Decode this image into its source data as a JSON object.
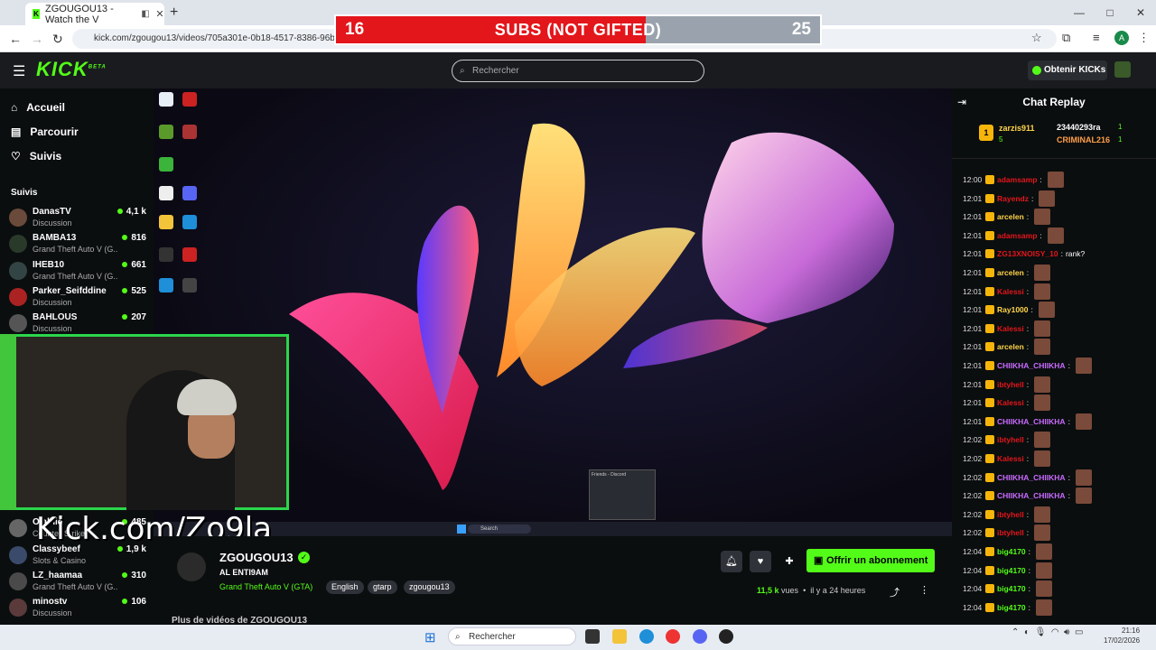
{
  "browser": {
    "tab_title": "ZGOUGOU13 - Watch the V",
    "tab_favicon": "kick-icon",
    "new_tab": "+",
    "url": "kick.com/zgougou13/videos/705a301e-0b18-4517-8386-96bb84",
    "profile_initial": "A",
    "window_controls": [
      "—",
      "□",
      "✕"
    ]
  },
  "overlay": {
    "sub_goal_current": "16",
    "sub_goal_label": "SUBS (NOT GIFTED)",
    "sub_goal_target": "25",
    "sub_goal_progress": 0.64,
    "kick_link": "Kick.com/Zo9la"
  },
  "header": {
    "logo": "KICK",
    "logo_badge": "BETA",
    "search_placeholder": "Rechercher",
    "kicks_button": "Obtenir KICKs"
  },
  "sidebar": {
    "nav": [
      {
        "label": "Accueil",
        "icon": "home-icon"
      },
      {
        "label": "Parcourir",
        "icon": "browse-icon"
      },
      {
        "label": "Suivis",
        "icon": "heart-icon"
      }
    ],
    "following_header": "Suivis",
    "channels": [
      {
        "name": "DanasTV",
        "category": "Discussion",
        "viewers": "4,1 k"
      },
      {
        "name": "BAMBA13",
        "category": "Grand Theft Auto V (G...",
        "viewers": "816"
      },
      {
        "name": "IHEB10",
        "category": "Grand Theft Auto V (G...",
        "viewers": "661"
      },
      {
        "name": "Parker_Seifddine",
        "category": "Discussion",
        "viewers": "525"
      },
      {
        "name": "BAHLOUS",
        "category": "Discussion",
        "viewers": "207"
      },
      {
        "name": "Ojalhie",
        "category": "Counter-Strike",
        "viewers": "485"
      },
      {
        "name": "Classybeef",
        "category": "Slots & Casino",
        "viewers": "1,9 k"
      },
      {
        "name": "LZ_haamaa",
        "category": "Grand Theft Auto V (G...",
        "viewers": "310"
      },
      {
        "name": "minostv",
        "category": "Discussion",
        "viewers": "106"
      }
    ]
  },
  "video_desktop": {
    "taskbar_search": "Search",
    "discord_preview": "Friends - Discord"
  },
  "channel": {
    "name": "ZGOUGOU13",
    "title": "AL ENTI9AM",
    "category": "Grand Theft Auto V (GTA)",
    "tags": [
      "English",
      "gtarp",
      "zgougou13"
    ],
    "subscribe_button": "Offrir un abonnement",
    "views_count": "11,5 k",
    "views_label": "vues",
    "age": "il y a 24 heures",
    "more_videos": "Plus de vidéos de ZGOUGOU13"
  },
  "chat": {
    "title": "Chat Replay",
    "leaderboard": [
      {
        "rank": "1",
        "name": "zarzis911",
        "sub": "5"
      },
      {
        "name": "23440293ra",
        "count": "1"
      },
      {
        "name": "CRIMINAL216",
        "count": "1"
      }
    ],
    "messages": [
      {
        "time": "12:00",
        "user": "adamsamp",
        "text": "",
        "color": "#e3161b"
      },
      {
        "time": "12:01",
        "user": "Rayendz",
        "text": "",
        "color": "#e3161b"
      },
      {
        "time": "12:01",
        "user": "arcelen",
        "text": "",
        "color": "#ffd54a"
      },
      {
        "time": "12:01",
        "user": "adamsamp",
        "text": "",
        "color": "#e3161b"
      },
      {
        "time": "12:01",
        "user": "ZG13XNOISY_10",
        "text": "rank?",
        "color": "#e3161b"
      },
      {
        "time": "12:01",
        "user": "arcelen",
        "text": "",
        "color": "#ffd54a"
      },
      {
        "time": "12:01",
        "user": "Kalessi",
        "text": "",
        "color": "#e3161b"
      },
      {
        "time": "12:01",
        "user": "Ray1000",
        "text": "",
        "color": "#ffd54a"
      },
      {
        "time": "12:01",
        "user": "Kalessi",
        "text": "",
        "color": "#e3161b"
      },
      {
        "time": "12:01",
        "user": "arcelen",
        "text": "",
        "color": "#ffd54a"
      },
      {
        "time": "12:01",
        "user": "CHIIKHA_CHIIKHA",
        "text": "",
        "color": "#c86bff"
      },
      {
        "time": "12:01",
        "user": "ibtyhell",
        "text": "",
        "color": "#e3161b"
      },
      {
        "time": "12:01",
        "user": "Kalessi",
        "text": "",
        "color": "#e3161b"
      },
      {
        "time": "12:01",
        "user": "CHIIKHA_CHIIKHA",
        "text": "",
        "color": "#c86bff"
      },
      {
        "time": "12:02",
        "user": "ibtyhell",
        "text": "",
        "color": "#e3161b"
      },
      {
        "time": "12:02",
        "user": "Kalessi",
        "text": "",
        "color": "#e3161b"
      },
      {
        "time": "12:02",
        "user": "CHIIKHA_CHIIKHA",
        "text": "",
        "color": "#c86bff"
      },
      {
        "time": "12:02",
        "user": "CHIIKHA_CHIIKHA",
        "text": "",
        "color": "#c86bff"
      },
      {
        "time": "12:02",
        "user": "ibtyhell",
        "text": "",
        "color": "#e3161b"
      },
      {
        "time": "12:02",
        "user": "ibtyhell",
        "text": "",
        "color": "#e3161b"
      },
      {
        "time": "12:04",
        "user": "big4170",
        "text": "",
        "color": "#53fc18"
      },
      {
        "time": "12:04",
        "user": "big4170",
        "text": "",
        "color": "#53fc18"
      },
      {
        "time": "12:04",
        "user": "big4170",
        "text": "",
        "color": "#53fc18"
      },
      {
        "time": "12:04",
        "user": "big4170",
        "text": "",
        "color": "#53fc18"
      }
    ]
  },
  "taskbar": {
    "search_placeholder": "Rechercher",
    "time": "21:16",
    "date": "17/02/2026"
  },
  "colors": {
    "kick_green": "#53fc18",
    "goal_red": "#e3161b"
  }
}
